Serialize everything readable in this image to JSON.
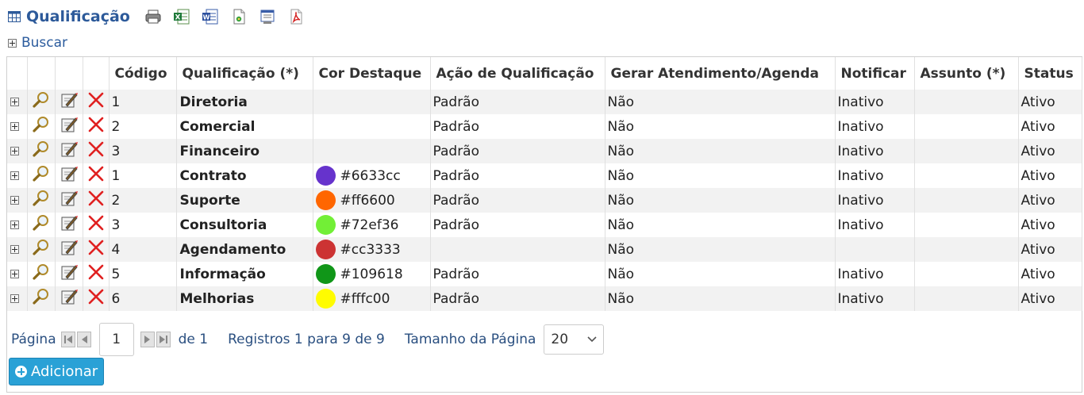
{
  "header": {
    "title": "Qualificação",
    "export_icons": [
      "print-icon",
      "excel-icon",
      "word-icon",
      "open-doc-icon",
      "html-icon",
      "pdf-icon"
    ]
  },
  "buscar_label": "Buscar",
  "table": {
    "columns": [
      "Código",
      "Qualificação (*)",
      "Cor Destaque",
      "Ação de Qualificação",
      "Gerar Atendimento/Agenda",
      "Notificar",
      "Assunto (*)",
      "Status"
    ],
    "rows": [
      {
        "codigo": "1",
        "qualificacao": "Diretoria",
        "cor": "",
        "acao": "Padrão",
        "gerar": "Não",
        "notificar": "Inativo",
        "assunto": "",
        "status": "Ativo"
      },
      {
        "codigo": "2",
        "qualificacao": "Comercial",
        "cor": "",
        "acao": "Padrão",
        "gerar": "Não",
        "notificar": "Inativo",
        "assunto": "",
        "status": "Ativo"
      },
      {
        "codigo": "3",
        "qualificacao": "Financeiro",
        "cor": "",
        "acao": "Padrão",
        "gerar": "Não",
        "notificar": "Inativo",
        "assunto": "",
        "status": "Ativo"
      },
      {
        "codigo": "1",
        "qualificacao": "Contrato",
        "cor": "#6633cc",
        "acao": "Padrão",
        "gerar": "Não",
        "notificar": "Inativo",
        "assunto": "",
        "status": "Ativo"
      },
      {
        "codigo": "2",
        "qualificacao": "Suporte",
        "cor": "#ff6600",
        "acao": "Padrão",
        "gerar": "Não",
        "notificar": "Inativo",
        "assunto": "",
        "status": "Ativo"
      },
      {
        "codigo": "3",
        "qualificacao": "Consultoria",
        "cor": "#72ef36",
        "acao": "Padrão",
        "gerar": "Não",
        "notificar": "Inativo",
        "assunto": "",
        "status": "Ativo"
      },
      {
        "codigo": "4",
        "qualificacao": "Agendamento",
        "cor": "#cc3333",
        "acao": "",
        "gerar": "Não",
        "notificar": "",
        "assunto": "",
        "status": "Ativo"
      },
      {
        "codigo": "5",
        "qualificacao": "Informação",
        "cor": "#109618",
        "acao": "Padrão",
        "gerar": "Não",
        "notificar": "Inativo",
        "assunto": "",
        "status": "Ativo"
      },
      {
        "codigo": "6",
        "qualificacao": "Melhorias",
        "cor": "#fffc00",
        "acao": "Padrão",
        "gerar": "Não",
        "notificar": "Inativo",
        "assunto": "",
        "status": "Ativo"
      }
    ]
  },
  "pager": {
    "pagina_label": "Página",
    "current_page": "1",
    "of_label": "de 1",
    "records_label": "Registros 1 para 9 de 9",
    "page_size_label": "Tamanho da Página",
    "page_size": "20"
  },
  "add_button_label": "Adicionar",
  "colors": {
    "title": "#2d5a9a",
    "link": "#2b5b9d",
    "row_alt": "#f2f2f2",
    "add_button": "#2aa1d6",
    "delete_red": "#e02020"
  }
}
